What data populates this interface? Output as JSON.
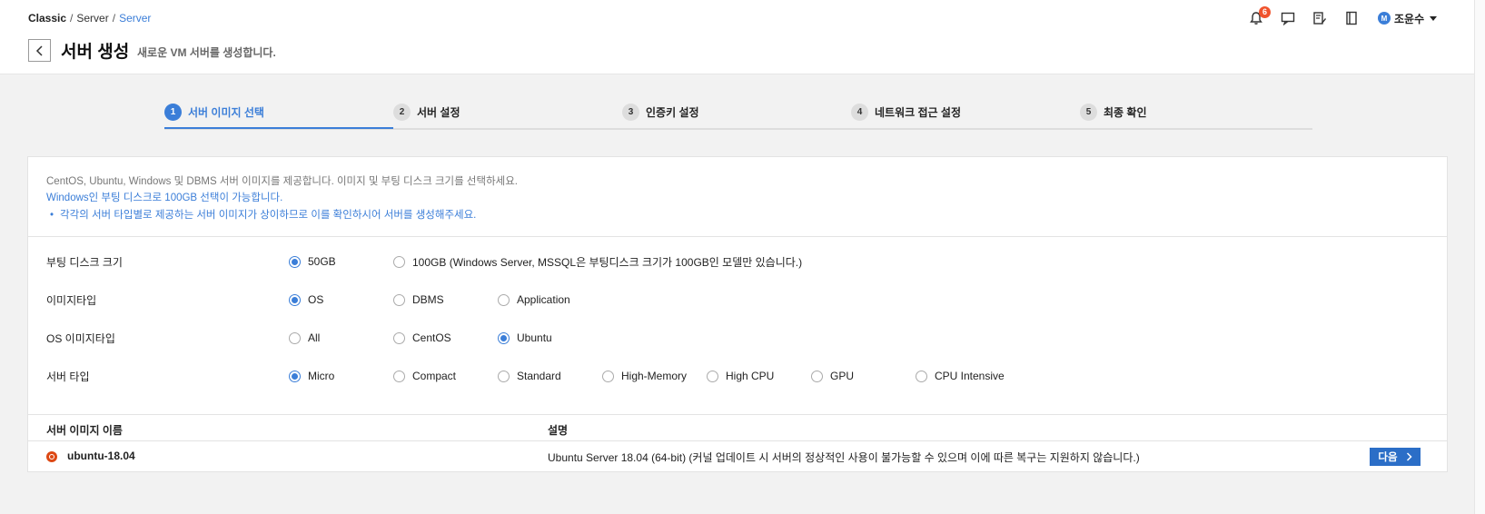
{
  "breadcrumb": {
    "root": "Classic",
    "sep": "/",
    "mid": "Server",
    "current": "Server"
  },
  "header": {
    "title": "서버 생성",
    "subtitle": "새로운 VM 서버를 생성합니다."
  },
  "notifications": {
    "count": "6"
  },
  "user": {
    "initial": "M",
    "name": "조윤수"
  },
  "steps": [
    {
      "num": "1",
      "label": "서버 이미지 선택"
    },
    {
      "num": "2",
      "label": "서버 설정"
    },
    {
      "num": "3",
      "label": "인증키 설정"
    },
    {
      "num": "4",
      "label": "네트워크 접근 설정"
    },
    {
      "num": "5",
      "label": "최종 확인"
    }
  ],
  "info": {
    "line1": "CentOS, Ubuntu, Windows 및 DBMS 서버 이미지를 제공합니다. 이미지 및 부팅 디스크 크기를 선택하세요.",
    "line2": "Windows인 부팅 디스크로 100GB 선택이 가능합니다.",
    "bullet": "각각의 서버 타입별로 제공하는 서버 이미지가 상이하므로 이를 확인하시어 서버를 생성해주세요."
  },
  "form": {
    "boot_disk": {
      "label": "부팅 디스크 크기",
      "options": [
        "50GB",
        "100GB (Windows Server, MSSQL은 부팅디스크 크기가 100GB인 모델만 있습니다.)"
      ],
      "selected": 0
    },
    "image_type": {
      "label": "이미지타입",
      "options": [
        "OS",
        "DBMS",
        "Application"
      ],
      "selected": 0
    },
    "os_image_type": {
      "label": "OS 이미지타입",
      "options": [
        "All",
        "CentOS",
        "Ubuntu"
      ],
      "selected": 2
    },
    "server_type": {
      "label": "서버 타입",
      "options": [
        "Micro",
        "Compact",
        "Standard",
        "High-Memory",
        "High CPU",
        "GPU",
        "CPU Intensive"
      ],
      "selected": 0
    }
  },
  "table": {
    "col_name": "서버 이미지 이름",
    "col_desc": "설명",
    "rows": [
      {
        "name": "ubuntu-18.04",
        "desc": "Ubuntu Server 18.04 (64-bit) (커널 업데이트 시 서버의 정상적인 사용이 불가능할 수 있으며 이에 따른 복구는 지원하지 않습니다.)",
        "action": "다음"
      }
    ]
  },
  "colors": {
    "accent": "#3b7ed8",
    "button": "#2b6ec7",
    "badge": "#f0532d",
    "ubuntu": "#dd4814"
  }
}
